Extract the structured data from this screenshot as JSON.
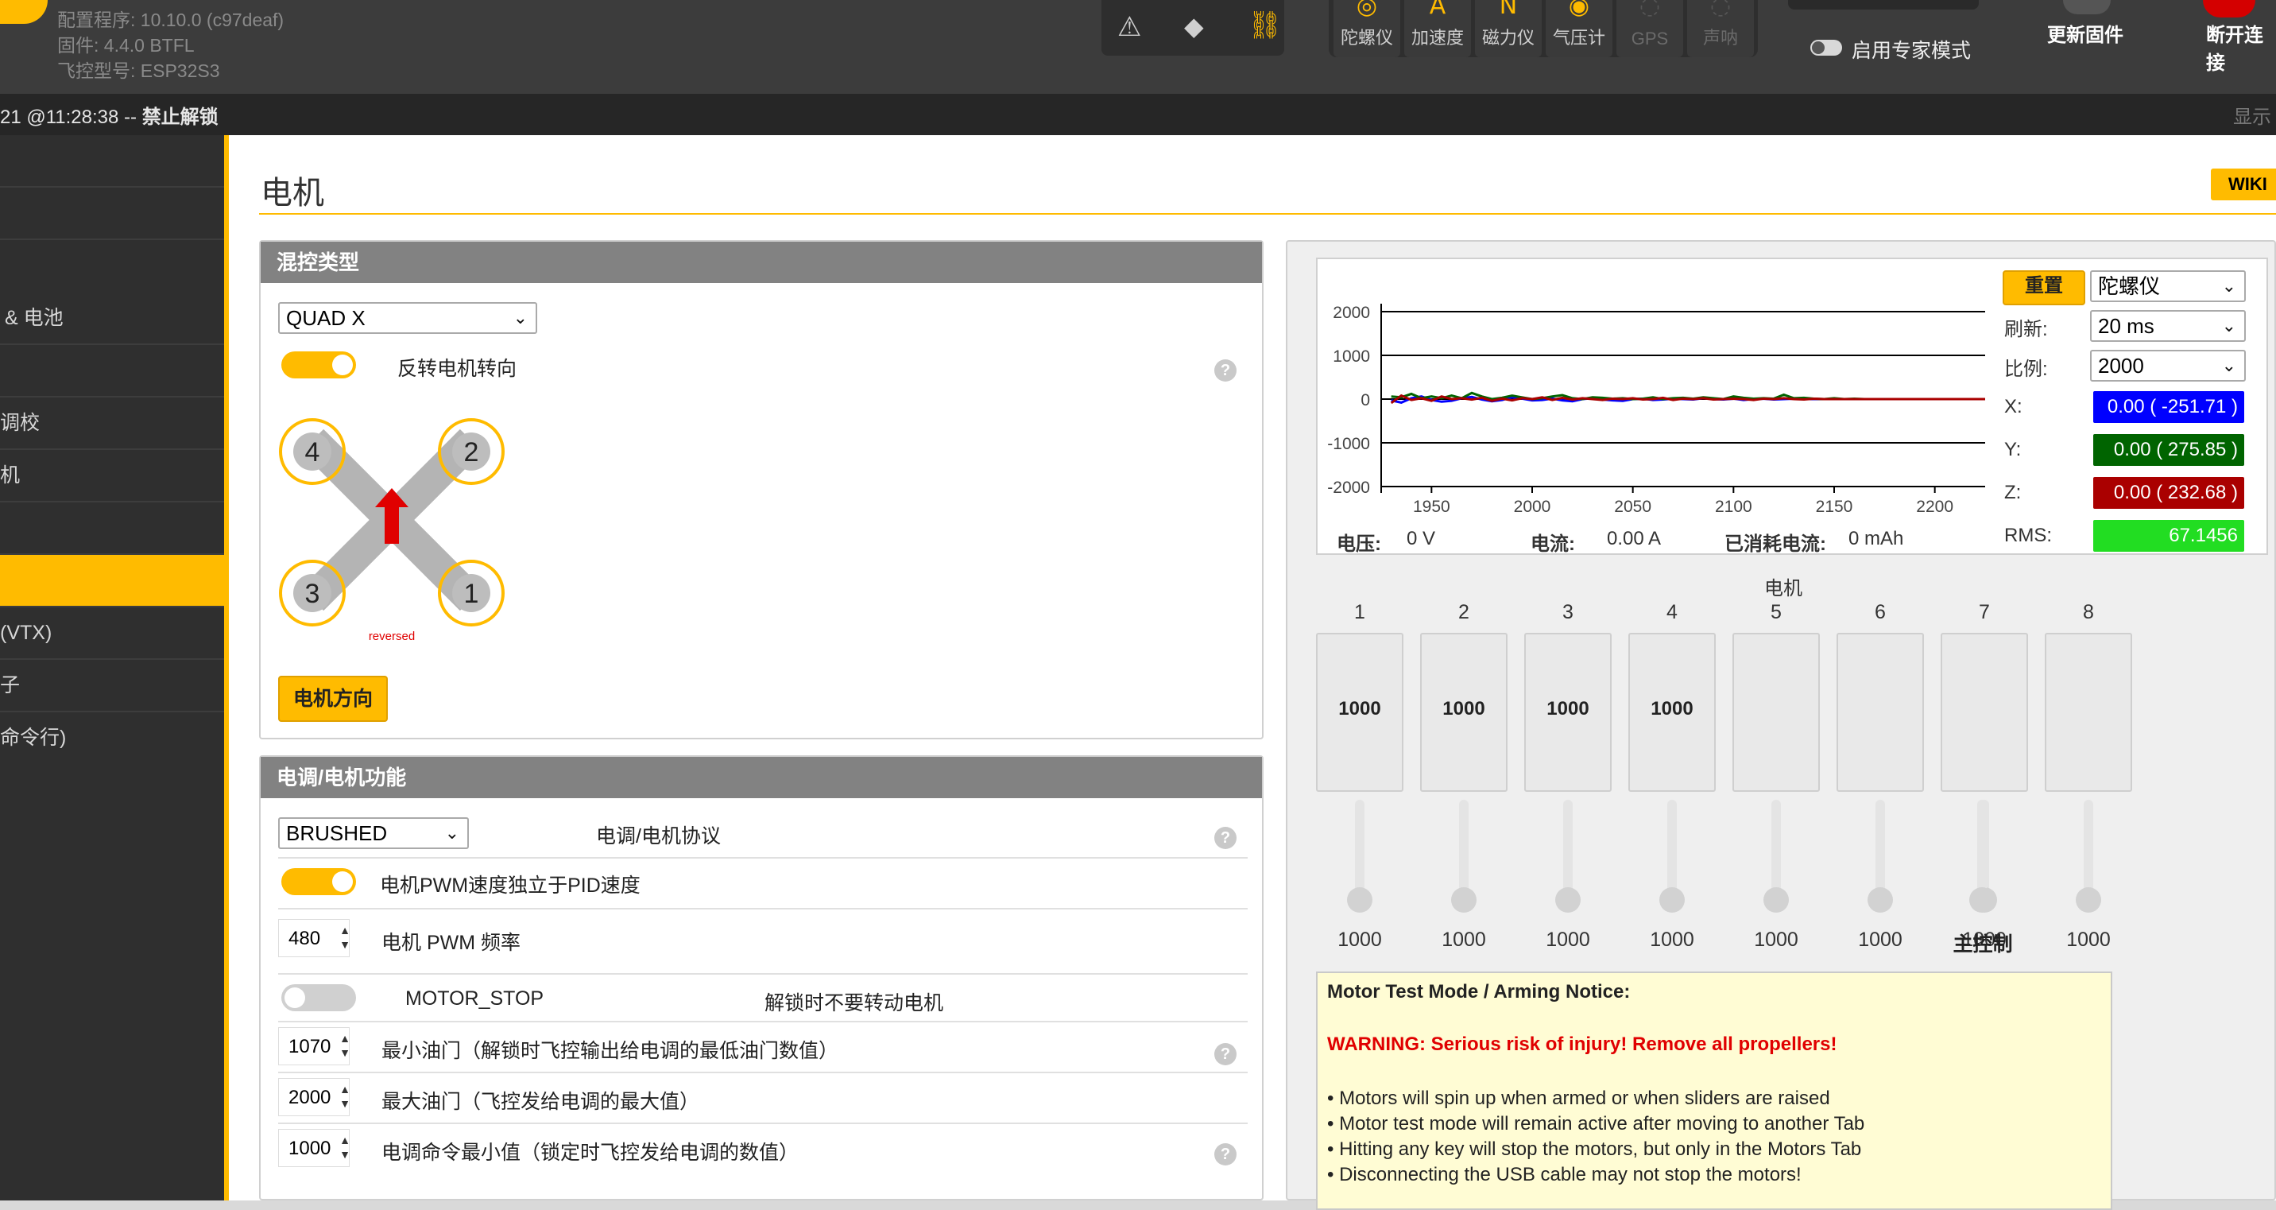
{
  "header": {
    "config_line": "配置程序: 10.10.0 (c97deaf)",
    "firmware_line": "固件: 4.4.0 BTFL",
    "board_line": "飞控型号: ESP32S3",
    "sensors": [
      {
        "label": "陀螺仪",
        "active": true
      },
      {
        "label": "加速度",
        "active": true
      },
      {
        "label": "磁力仪",
        "active": true
      },
      {
        "label": "气压计",
        "active": true
      },
      {
        "label": "GPS",
        "active": false
      },
      {
        "label": "声呐",
        "active": false
      }
    ],
    "expert_mode_label": "启用专家模式",
    "update_firmware_label": "更新固件",
    "disconnect_label": "断开连接"
  },
  "status_bar": {
    "text_prefix": "21 @11:28:38 -- ",
    "text_bold": "禁止解锁",
    "right_text": "显示"
  },
  "sidebar": {
    "items": [
      {
        "label": ""
      },
      {
        "label": ""
      },
      {
        "label": "& 电池"
      },
      {
        "label": ""
      },
      {
        "label": "调校"
      },
      {
        "label": "机"
      },
      {
        "label": ""
      },
      {
        "label": "",
        "active": true
      },
      {
        "label": "(VTX)"
      },
      {
        "label": "子"
      },
      {
        "label": "命令行)"
      }
    ]
  },
  "page": {
    "title": "电机",
    "wiki_label": "WIKI"
  },
  "mixer": {
    "header": "混控类型",
    "type_value": "QUAD X",
    "reverse_label": "反转电机转向",
    "reversed_text": "reversed",
    "motor_numbers": [
      "4",
      "2",
      "3",
      "1"
    ],
    "direction_button": "电机方向"
  },
  "esc": {
    "header": "电调/电机功能",
    "protocol_value": "BRUSHED",
    "protocol_label": "电调/电机协议",
    "pwm_independent_label": "电机PWM速度独立于PID速度",
    "pwm_freq_value": "480",
    "pwm_freq_label": "电机 PWM 频率",
    "motor_stop_label": "MOTOR_STOP",
    "motor_stop_desc": "解锁时不要转动电机",
    "min_throttle_value": "1070",
    "min_throttle_label": "最小油门（解锁时飞控输出给电调的最低油门数值）",
    "max_throttle_value": "2000",
    "max_throttle_label": "最大油门（飞控发给电调的最大值）",
    "min_command_value": "1000",
    "min_command_label": "电调命令最小值（锁定时飞控发给电调的数值）"
  },
  "graph": {
    "reset_label": "重置",
    "sensor_select": "陀螺仪",
    "refresh_label": "刷新:",
    "refresh_value": "20 ms",
    "scale_label": "比例:",
    "scale_value": "2000",
    "x_label": "X:",
    "x_value": "0.00 ( -251.71 )",
    "y_label": "Y:",
    "y_value": "0.00 ( 275.85 )",
    "z_label": "Z:",
    "z_value": "0.00 ( 232.68 )",
    "rms_label": "RMS:",
    "rms_value": "67.1456",
    "voltage_label": "电压:",
    "voltage_value": "0 V",
    "current_label": "电流:",
    "current_value": "0.00 A",
    "consumed_label": "已消耗电流:",
    "consumed_value": "0 mAh",
    "colors": {
      "x": "#0000ff",
      "y": "#006400",
      "z": "#aa0000",
      "rms": "#22dd22"
    }
  },
  "chart_data": {
    "type": "line",
    "x": [
      1930,
      1935,
      1940,
      1945,
      1950,
      1955,
      1960,
      1965,
      1970,
      1975,
      1980,
      1985,
      1990,
      1995,
      2000,
      2005,
      2010,
      2015,
      2020,
      2025,
      2030,
      2035,
      2040,
      2045,
      2050,
      2055,
      2060,
      2065,
      2070,
      2075,
      2080,
      2085,
      2090,
      2095,
      2100,
      2105,
      2110,
      2115,
      2120,
      2125,
      2130,
      2135,
      2140,
      2145,
      2150,
      2155,
      2160,
      2165,
      2170,
      2175
    ],
    "x_ticks": [
      1950,
      2000,
      2050,
      2100,
      2150,
      2200
    ],
    "y_ticks": [
      2000,
      1000,
      0,
      -1000,
      -2000
    ],
    "ylim": [
      -2000,
      2000
    ],
    "xlim": [
      1925,
      2225
    ],
    "series": [
      {
        "name": "X",
        "color": "#0000ff",
        "values": [
          -30,
          -80,
          20,
          60,
          -20,
          -60,
          -40,
          20,
          50,
          -10,
          -50,
          -20,
          40,
          10,
          -30,
          -20,
          10,
          -30,
          -50,
          0,
          20,
          -10,
          -30,
          -40,
          0,
          10,
          -20,
          -10,
          10,
          0,
          -10,
          20,
          0,
          -10,
          10,
          -20,
          0,
          10,
          -10,
          0,
          10,
          0,
          0,
          0,
          0,
          0,
          0,
          0,
          0,
          0
        ]
      },
      {
        "name": "Y",
        "color": "#006400",
        "values": [
          60,
          40,
          120,
          20,
          60,
          20,
          80,
          20,
          140,
          60,
          0,
          30,
          80,
          40,
          0,
          20,
          60,
          90,
          20,
          0,
          40,
          30,
          10,
          20,
          0,
          10,
          40,
          0,
          20,
          30,
          10,
          40,
          20,
          0,
          60,
          30,
          10,
          20,
          10,
          100,
          20,
          30,
          10,
          0,
          20,
          0,
          10,
          0,
          0,
          0
        ]
      },
      {
        "name": "Z",
        "color": "#aa0000",
        "values": [
          -90,
          80,
          -20,
          20,
          -40,
          60,
          0,
          20,
          -10,
          30,
          -40,
          10,
          -30,
          20,
          0,
          40,
          -20,
          30,
          -10,
          20,
          0,
          -20,
          10,
          0,
          20,
          -10,
          0,
          30,
          -20,
          10,
          0,
          20,
          -10,
          0,
          10,
          0,
          -20,
          10,
          0,
          20,
          0,
          -10,
          10,
          0,
          0,
          0,
          0,
          0,
          0,
          0
        ]
      }
    ]
  },
  "motors": {
    "title": "电机",
    "columns": [
      "1",
      "2",
      "3",
      "4",
      "5",
      "6",
      "7",
      "8"
    ],
    "bar_values": [
      "1000",
      "1000",
      "1000",
      "1000",
      "",
      "",
      "",
      ""
    ],
    "slider_values": [
      "1000",
      "1000",
      "1000",
      "1000",
      "1000",
      "1000",
      "1000",
      "1000"
    ],
    "master_label": "主控制"
  },
  "notice": {
    "title": "Motor Test Mode / Arming Notice:",
    "warning": "WARNING: Serious risk of injury! Remove all propellers!",
    "bullets": [
      "• Motors will spin up when armed or when sliders are raised",
      "• Motor test mode will remain active after moving to another Tab",
      "• Hitting any key will stop the motors, but only in the Motors Tab",
      "• Disconnecting the USB cable may not stop the motors!"
    ]
  }
}
